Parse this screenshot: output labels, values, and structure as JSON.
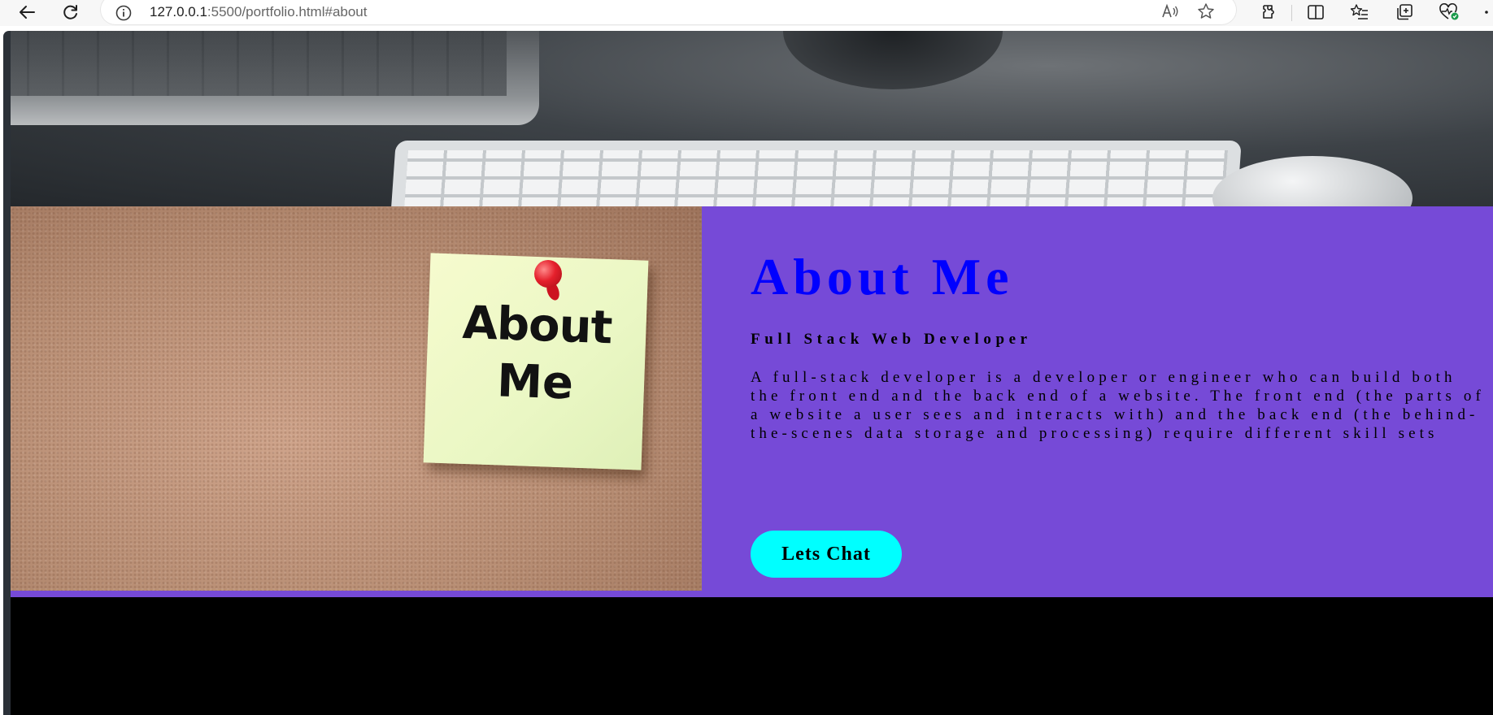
{
  "browser": {
    "url_host": "127.0.0.1",
    "url_rest": ":5500/portfolio.html#about",
    "icons": [
      "back-icon",
      "refresh-icon",
      "info-icon",
      "read-aloud-icon",
      "favorite-star-icon",
      "extensions-icon",
      "split-screen-icon",
      "favorites-icon",
      "collections-icon",
      "browser-health-icon",
      "more-icon"
    ]
  },
  "hero": {
    "image": "desk-keyboard-photo"
  },
  "about": {
    "image": "cork-board-sticky-note",
    "note_line1": "About",
    "note_line2": "Me",
    "title": "About Me",
    "subtitle": "Full Stack Web Developer",
    "description": "A full-stack developer is a developer or engineer who can build both the front end and the back end of a website. The front end (the parts of a website a user sees and interacts with) and the back end (the behind-the-scenes data storage and processing) require different skill sets",
    "button_label": "Lets Chat"
  },
  "colors": {
    "about_bg": "#764ad7",
    "title": "#0000ff",
    "button_bg": "#00ffff",
    "footer_bg": "#000000"
  }
}
